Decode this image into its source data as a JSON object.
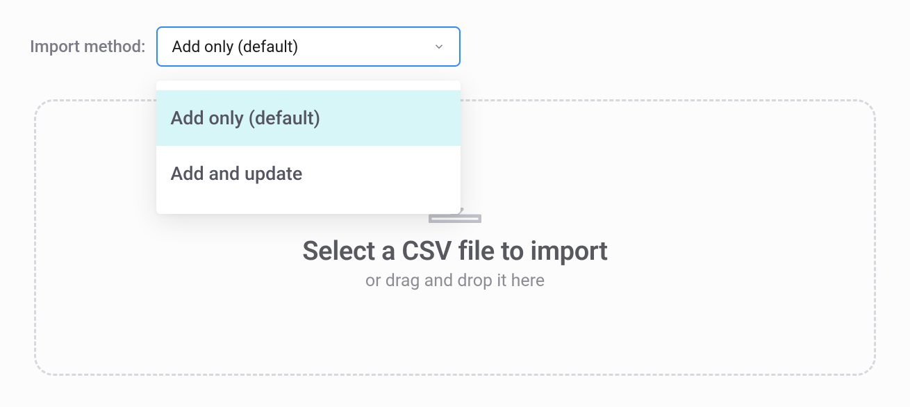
{
  "import_method": {
    "label": "Import method:",
    "selected": "Add only (default)",
    "options": [
      "Add only (default)",
      "Add and update"
    ]
  },
  "dropzone": {
    "title": "Select a CSV file to import",
    "subtitle": "or drag and drop it here"
  }
}
